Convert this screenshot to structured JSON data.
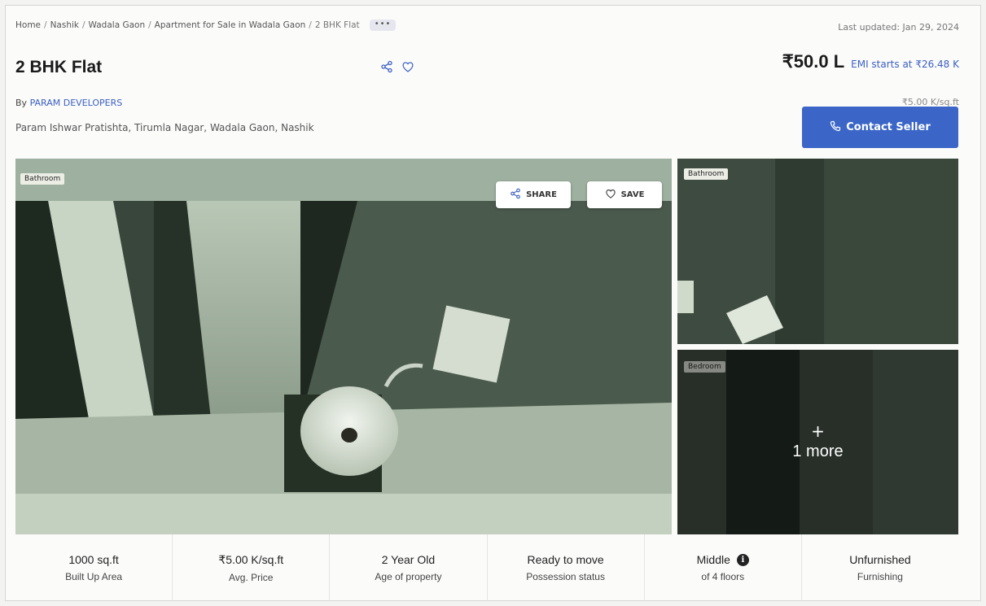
{
  "breadcrumb": {
    "items": [
      "Home",
      "Nashik",
      "Wadala Gaon",
      "Apartment for Sale in Wadala Gaon"
    ],
    "current": "2 BHK Flat",
    "more_label": "•••"
  },
  "last_updated": "Last updated: Jan 29, 2024",
  "listing": {
    "title": "2 BHK Flat",
    "by_prefix": "By",
    "developer": "PARAM DEVELOPERS",
    "address": "Param Ishwar Pratishta, Tirumla Nagar, Wadala Gaon, Nashik"
  },
  "pricing": {
    "price": "₹50.0 L",
    "emi": "EMI starts at ₹26.48 K",
    "per_sqft": "₹5.00 K/sq.ft"
  },
  "contact_button": "Contact Seller",
  "gallery": {
    "main_tag": "Bathroom",
    "share_label": "SHARE",
    "save_label": "SAVE",
    "side1_tag": "Bathroom",
    "side2_tag": "Bedroom",
    "more_plus": "+",
    "more_text": "1 more"
  },
  "stats": [
    {
      "value": "1000 sq.ft",
      "label": "Built Up Area"
    },
    {
      "value": "₹5.00 K/sq.ft",
      "label": "Avg. Price"
    },
    {
      "value": "2 Year Old",
      "label": "Age of property"
    },
    {
      "value": "Ready to move",
      "label": "Possession status"
    },
    {
      "value": "Middle",
      "label": "of 4 floors"
    },
    {
      "value": "Unfurnished",
      "label": "Furnishing"
    }
  ],
  "colors": {
    "accent_blue": "#3b66c8",
    "link_blue": "#3a5fc4"
  },
  "icons": [
    "share-icon",
    "heart-icon",
    "phone-icon",
    "info-icon"
  ]
}
